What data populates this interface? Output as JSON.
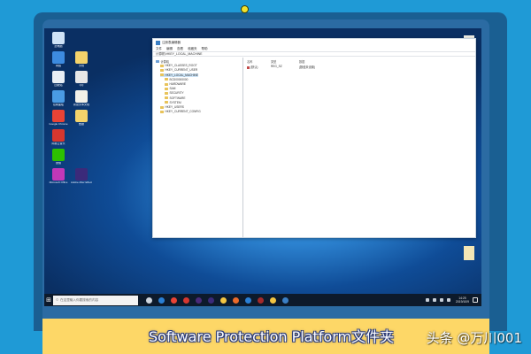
{
  "regedit": {
    "title": "注册表编辑器",
    "menu": [
      "文件",
      "编辑",
      "查看",
      "收藏夹",
      "帮助"
    ],
    "address": "计算机\\HKEY_LOCAL_MACHINE",
    "tree": [
      {
        "label": "计算机",
        "level": 0,
        "selected": false
      },
      {
        "label": "HKEY_CLASSES_ROOT",
        "level": 1,
        "selected": false
      },
      {
        "label": "HKEY_CURRENT_USER",
        "level": 1,
        "selected": false
      },
      {
        "label": "HKEY_LOCAL_MACHINE",
        "level": 1,
        "selected": true
      },
      {
        "label": "BCD00000000",
        "level": 2,
        "selected": false
      },
      {
        "label": "HARDWARE",
        "level": 2,
        "selected": false
      },
      {
        "label": "SAM",
        "level": 2,
        "selected": false
      },
      {
        "label": "SECURITY",
        "level": 2,
        "selected": false
      },
      {
        "label": "SOFTWARE",
        "level": 2,
        "selected": false
      },
      {
        "label": "SYSTEM",
        "level": 2,
        "selected": false
      },
      {
        "label": "HKEY_USERS",
        "level": 1,
        "selected": false
      },
      {
        "label": "HKEY_CURRENT_CONFIG",
        "level": 1,
        "selected": false
      }
    ],
    "columns": [
      "名称",
      "类型",
      "数据"
    ],
    "rows": [
      {
        "name": "(默认)",
        "type": "REG_SZ",
        "data": "(数值未设置)"
      }
    ]
  },
  "desktop": {
    "icons": [
      {
        "label": "此电脑",
        "icon": "computer-icon",
        "color": "#cfe3f7"
      },
      {
        "label": "网络",
        "icon": "network-icon",
        "color": "#3d8be0"
      },
      {
        "label": "回收站",
        "icon": "recycle-bin-icon",
        "color": "#e8eef5"
      },
      {
        "label": "控制面板",
        "icon": "control-panel-icon",
        "color": "#4a9be4"
      },
      {
        "label": "Google Chrome",
        "icon": "chrome-icon",
        "color": "#e94335"
      },
      {
        "label": "网易云音乐",
        "icon": "music-icon",
        "color": "#d6372f"
      },
      {
        "label": "微信",
        "icon": "wechat-icon",
        "color": "#2dc100"
      },
      {
        "label": "Microsoft Office",
        "icon": "office-icon",
        "color": "#c238b8"
      },
      {
        "label": "文档",
        "icon": "folder-icon",
        "color": "#f4d36b"
      },
      {
        "label": "QQ",
        "icon": "qq-icon",
        "color": "#e7e7e7"
      },
      {
        "label": "新建文本文档",
        "icon": "text-file-icon",
        "color": "#f3f1e8"
      },
      {
        "label": "数据",
        "icon": "folder-icon",
        "color": "#f4d36b"
      },
      {
        "label": "Adobe After Effects",
        "icon": "after-effects-icon",
        "color": "#3b2a7a"
      }
    ]
  },
  "taskbar": {
    "search_placeholder": "在这里输入你要搜索的内容",
    "apps": [
      {
        "icon": "task-view-icon",
        "color": "#cfd6df"
      },
      {
        "icon": "edge-icon",
        "color": "#2a7fd4"
      },
      {
        "icon": "chrome-icon",
        "color": "#e94335"
      },
      {
        "icon": "music-icon",
        "color": "#d6372f"
      },
      {
        "icon": "premiere-icon",
        "color": "#4a2a7a"
      },
      {
        "icon": "after-effects-icon",
        "color": "#3b2a7a"
      },
      {
        "icon": "file-explorer-icon",
        "color": "#f4c542"
      },
      {
        "icon": "media-player-icon",
        "color": "#ea6a2a"
      },
      {
        "icon": "store-icon",
        "color": "#2a7fd4"
      },
      {
        "icon": "app-icon",
        "color": "#a42a2a"
      },
      {
        "icon": "app-icon",
        "color": "#f4c542"
      },
      {
        "icon": "regedit-icon",
        "color": "#3b7fc4"
      }
    ],
    "time": "14:25",
    "date": "2019/10/9"
  },
  "caption": "Software Protection Platform文件夹",
  "watermark": "头条 @万川001",
  "colors": {
    "accent": "#1f9ad6",
    "caption_bar": "#fdd767"
  }
}
